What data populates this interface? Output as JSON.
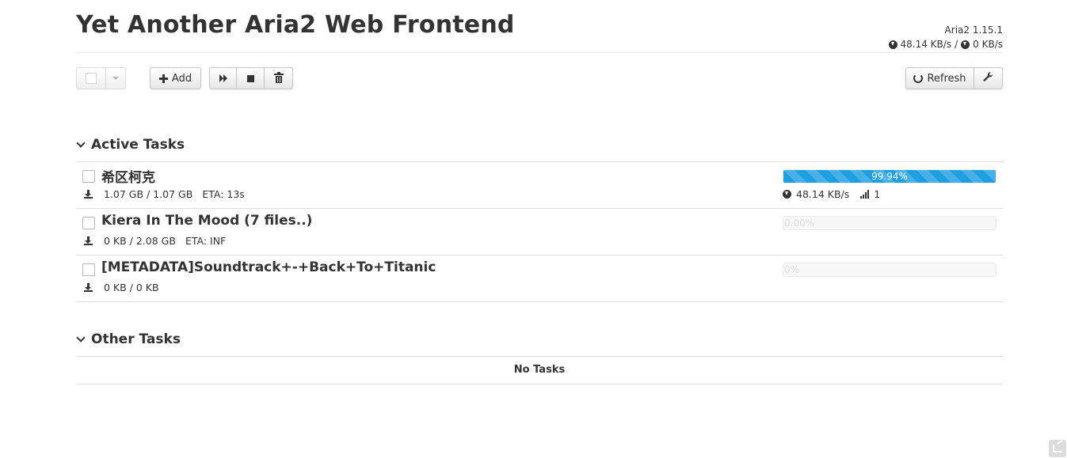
{
  "app": {
    "title": "Yet Another Aria2 Web Frontend",
    "version": "Aria2 1.15.1",
    "download_speed": "48.14 KB/s",
    "separator": "/",
    "upload_speed": "0 KB/s"
  },
  "toolbar": {
    "add_label": "Add",
    "refresh_label": "Refresh"
  },
  "icons": {
    "select": "checkbox-icon",
    "dropdown": "caret-down-icon",
    "add": "plus-icon",
    "start": "fast-forward-icon",
    "stop": "stop-icon",
    "remove": "trash-icon",
    "refresh": "refresh-icon",
    "settings": "wrench-icon",
    "task_download": "download-icon",
    "speed": "download-circle-icon",
    "connections": "signal-icon",
    "share": "share-icon"
  },
  "colors": {
    "progress_active": "#1e9fe0",
    "border": "#dddddd"
  },
  "active_section": {
    "title": "Active Tasks",
    "tasks": [
      {
        "name": "希区柯克",
        "size": "1.07 GB / 1.07 GB",
        "eta": "ETA: 13s",
        "progress_label": "99.94%",
        "progress": 0.9994,
        "speed": "48.14 KB/s",
        "connections": "1"
      },
      {
        "name": "Kiera In The Mood (7 files..)",
        "size": "0 KB / 2.08 GB",
        "eta": "ETA: INF",
        "progress_label": "0.00%",
        "progress": 0.0
      },
      {
        "name": "[METADATA]Soundtrack+-+Back+To+Titanic",
        "size": "0 KB / 0 KB",
        "progress_label": "0%",
        "progress": 0.0
      }
    ]
  },
  "other_section": {
    "title": "Other Tasks",
    "empty_text": "No Tasks"
  }
}
